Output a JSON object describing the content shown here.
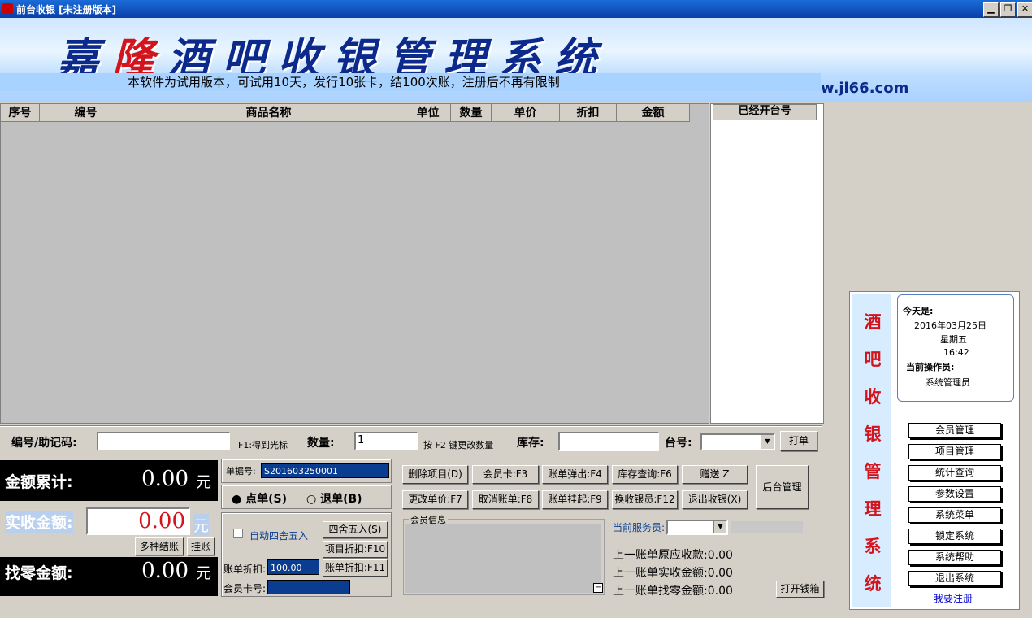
{
  "window": {
    "title": "前台收银 [未注册版本]",
    "min_label": "▁",
    "restore_label": "❐",
    "close_label": "✕"
  },
  "banner": {
    "title_a": "嘉",
    "title_red": "隆",
    "title_b": "酒吧收银管理系统",
    "trial_notice": "本软件为试用版本，可试用10天，发行10张卡，结100次账，注册后不再有限制",
    "url": "w.jl66.com"
  },
  "grid": {
    "columns": [
      "序号",
      "编号",
      "商品名称",
      "单位",
      "数量",
      "单价",
      "折扣",
      "金额"
    ],
    "rows": []
  },
  "tables_panel": {
    "header": "已经开台号"
  },
  "entry": {
    "code_label": "编号/助记码:",
    "code_value": "",
    "code_hint": "F1:得到光标",
    "qty_label": "数量:",
    "qty_value": "1",
    "qty_hint": "按 F2 键更改数量",
    "stock_label": "库存:",
    "stock_value": "",
    "table_label": "台号:",
    "table_value": "",
    "print_button": "打单"
  },
  "totals": {
    "sum_label": "金额累计:",
    "sum_value": "0.00",
    "unit": "元",
    "paid_label": "实收金额:",
    "paid_value": "0.00",
    "change_label": "找零金额:",
    "change_value": "0.00",
    "multi_pay_button": "多种结账",
    "hang_button": "挂账"
  },
  "bill": {
    "no_label": "单据号:",
    "no_value": "S201603250001",
    "order_radio": "点单(S)",
    "refund_radio": "退单(B)",
    "auto_round_label": "自动四舍五入",
    "round_button": "四舍五入(S)",
    "item_discount_button": "项目折扣:F10",
    "bill_discount_label": "账单折扣:",
    "bill_discount_value": "100.00",
    "bill_discount_button": "账单折扣:F11",
    "card_label": "会员卡号:",
    "card_value": ""
  },
  "actions": [
    "删除项目(D)",
    "会员卡:F3",
    "账单弹出:F4",
    "库存查询:F6",
    "赠送 Z",
    "更改单价:F7",
    "取消账单:F8",
    "账单挂起:F9",
    "换收银员:F12",
    "退出收银(X)"
  ],
  "backend_button": "后台管理",
  "member": {
    "group_label": "会员信息",
    "collapse": "−"
  },
  "service": {
    "label": "当前服务员:",
    "value": ""
  },
  "last_bill": {
    "due": "上一账单原应收款:0.00",
    "paid": "上一账单实收金额:0.00",
    "change": "上一账单找零金额:0.00"
  },
  "drawer_button": "打开钱箱",
  "side": {
    "vertical": [
      "酒",
      "吧",
      "收",
      "银",
      "管",
      "理",
      "系",
      "统"
    ],
    "today_label": "今天是:",
    "date": "2016年03月25日",
    "weekday": "星期五",
    "time": "16:42",
    "operator_label": "当前操作员:",
    "operator": "系统管理员",
    "menu": [
      "会员管理",
      "项目管理",
      "统计查询",
      "参数设置",
      "系统菜单",
      "锁定系统",
      "系统帮助",
      "退出系统"
    ],
    "register_link": "我要注册"
  },
  "colors": {
    "accent_red": "#d4141c",
    "title_blue": "#0b2a8c",
    "field_blue": "#0a3d8f"
  }
}
